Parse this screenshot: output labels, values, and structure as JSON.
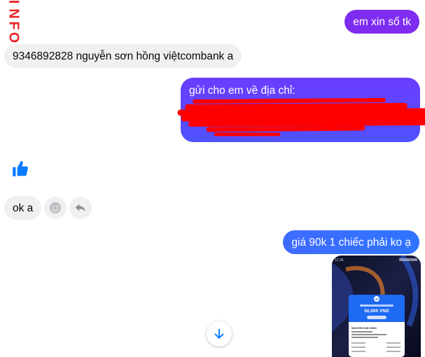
{
  "sidebar_logo": {
    "text": "INFO"
  },
  "messages": [
    {
      "id": "m1",
      "direction": "outgoing",
      "text": "em xin số tk"
    },
    {
      "id": "m2",
      "direction": "incoming",
      "text": "9346892828 nguyễn sơn hồng việtcombank a"
    },
    {
      "id": "m3",
      "direction": "outgoing",
      "text": "gửi cho em về địa chỉ:"
    },
    {
      "id": "m4",
      "direction": "incoming",
      "type": "like"
    },
    {
      "id": "m5",
      "direction": "incoming",
      "text": "ok a"
    },
    {
      "id": "m6",
      "direction": "outgoing",
      "text": "giá 90k 1 chiếc phải ko ạ"
    },
    {
      "id": "m7",
      "direction": "outgoing",
      "type": "image"
    }
  ],
  "screenshot_image": {
    "status_time": "12:36",
    "amount": "50,000 VND",
    "recipient": "NGUYEN SON HONG"
  },
  "icons": {
    "like": "thumbs-up-icon",
    "emoji": "smiley-icon",
    "reply": "reply-icon",
    "scroll": "arrow-down-icon"
  },
  "colors": {
    "accent_purple": "#7e2cf0",
    "accent_blue": "#2f74ff",
    "messenger_blue": "#0a7cff",
    "logo_red": "#e8262a",
    "redaction": "#ff0000"
  }
}
